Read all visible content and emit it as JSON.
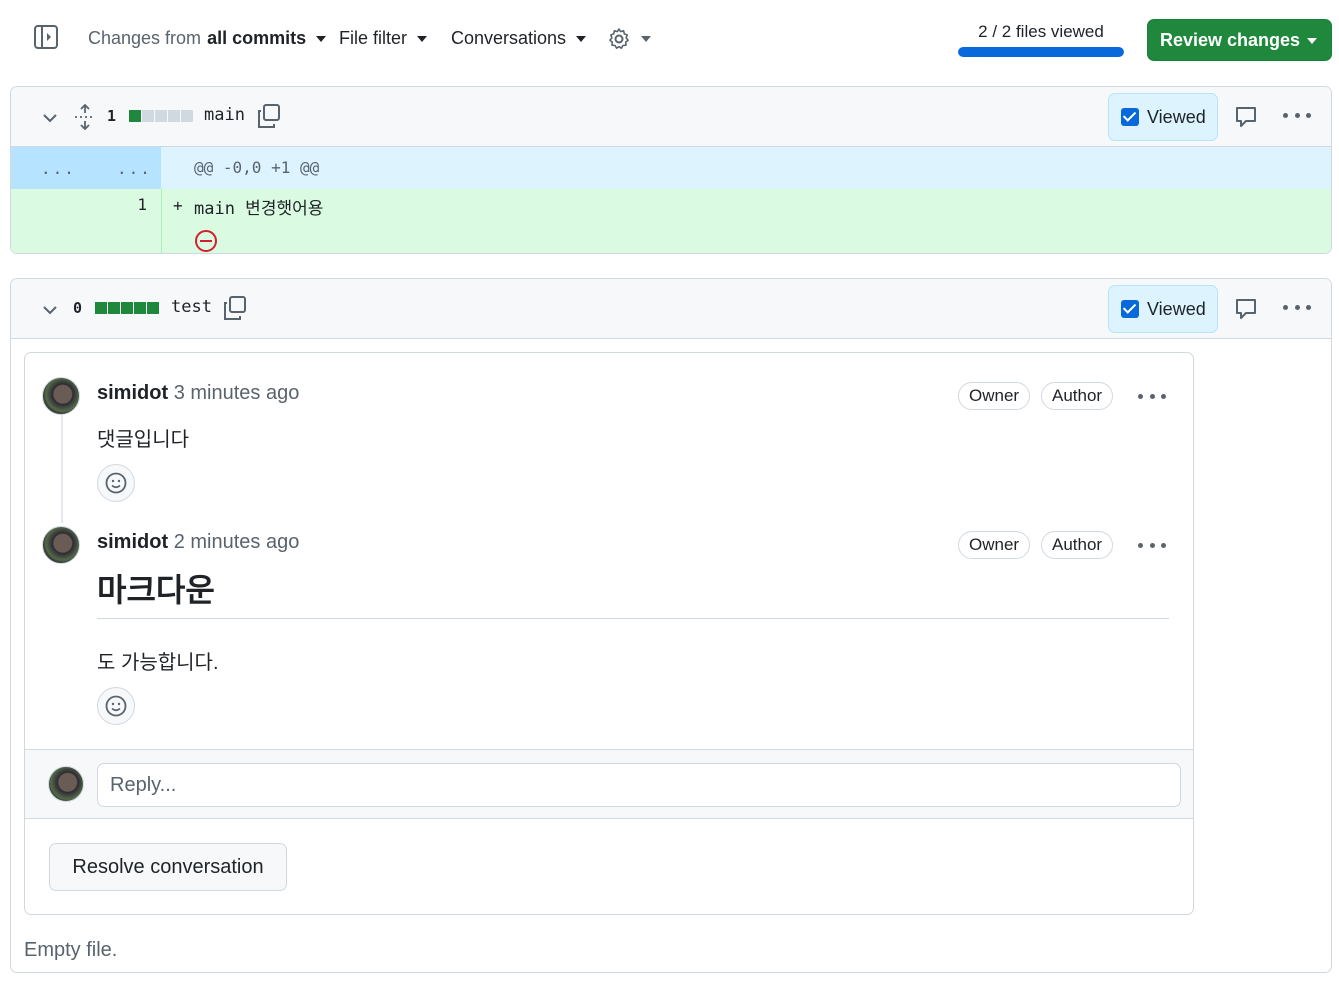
{
  "toolbar": {
    "changes_prefix": "Changes from",
    "changes_value": "all commits",
    "file_filter": "File filter",
    "conversations": "Conversations",
    "files_viewed": "2 / 2 files viewed",
    "files_viewed_progress": 1.0,
    "review_changes": "Review changes"
  },
  "files": [
    {
      "diff_count": "1",
      "diffstat": [
        "added",
        "neutral",
        "neutral",
        "neutral",
        "neutral"
      ],
      "name": "main",
      "viewed_label": "Viewed",
      "viewed": true,
      "hunk": {
        "old_marker": "...",
        "new_marker": "...",
        "header": "@@ -0,0 +1 @@"
      },
      "lines": [
        {
          "new_num": "1",
          "sign": "+",
          "code": "main 변경햇어용"
        }
      ]
    },
    {
      "diff_count": "0",
      "diffstat": [
        "added",
        "added",
        "added",
        "added",
        "added"
      ],
      "name": "test",
      "viewed_label": "Viewed",
      "viewed": true,
      "thread": {
        "comments": [
          {
            "author": "simidot",
            "time": "3 minutes ago",
            "badges": [
              "Owner",
              "Author"
            ],
            "body": "댓글입니다"
          },
          {
            "author": "simidot",
            "time": "2 minutes ago",
            "badges": [
              "Owner",
              "Author"
            ],
            "heading": "마크다운",
            "body": "도 가능합니다."
          }
        ],
        "reply_placeholder": "Reply...",
        "resolve_label": "Resolve conversation"
      },
      "empty_note": "Empty file."
    }
  ],
  "colors": {
    "accent_green": "#1f883d",
    "accent_blue": "#0969da",
    "hunk_bg": "#ddf4ff",
    "add_bg": "#dafbe1",
    "danger_red": "#cf222e"
  }
}
